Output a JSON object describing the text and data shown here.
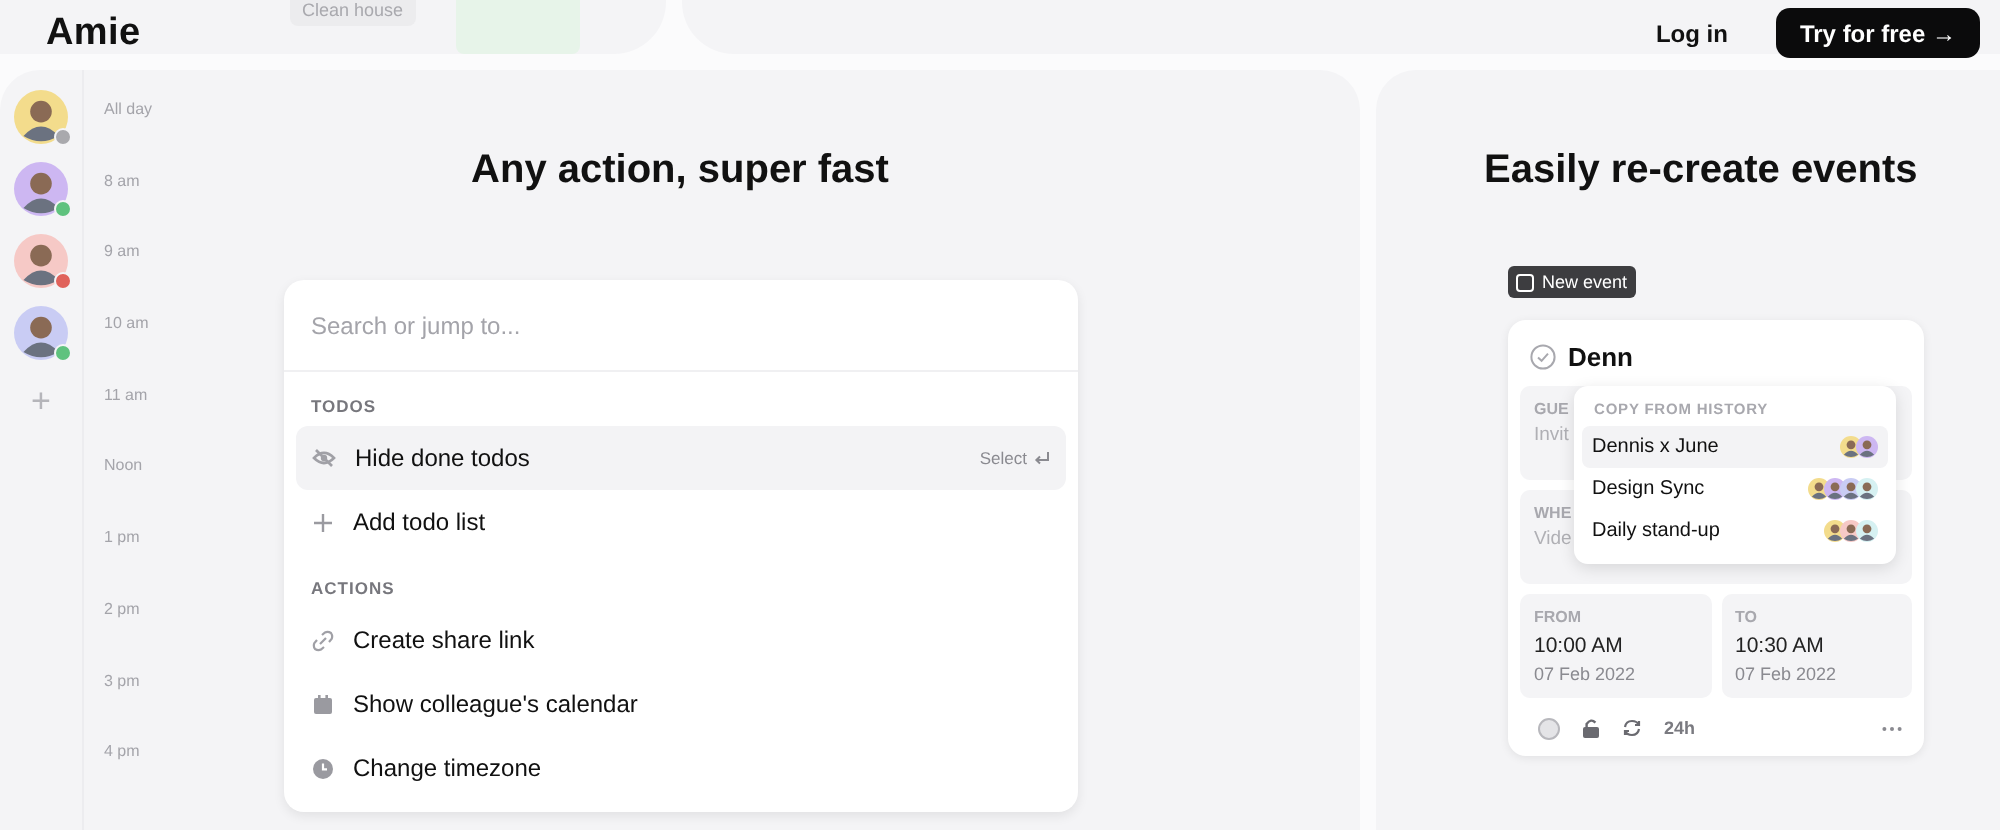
{
  "header": {
    "logo": "Amie",
    "background_cell": "Clean house",
    "login": "Log in",
    "cta": "Try for free →"
  },
  "left_panel": {
    "title": "Any action, super fast",
    "people": [
      {
        "color": "#a9a9ad"
      },
      {
        "color": "#5fc27e"
      },
      {
        "color": "#e0625b"
      },
      {
        "color": "#5fc27e"
      }
    ],
    "add": "+",
    "times": [
      "All day",
      "8 am",
      "9 am",
      "10 am",
      "11 am",
      "Noon",
      "1 pm",
      "2 pm",
      "3 pm",
      "4 pm"
    ],
    "palette": {
      "placeholder": "Search or jump to...",
      "sections": [
        {
          "heading": "TODOS",
          "items": [
            {
              "label": "Hide done todos",
              "selected": true,
              "hint": "Select"
            },
            {
              "label": "Add todo list",
              "selected": false
            }
          ]
        },
        {
          "heading": "ACTIONS",
          "items": [
            {
              "label": "Create share link",
              "selected": false
            },
            {
              "label": "Show colleague's calendar",
              "selected": false
            },
            {
              "label": "Change timezone",
              "selected": false
            }
          ]
        }
      ]
    }
  },
  "right_panel": {
    "title": "Easily re-create events",
    "chip": "New event",
    "event": {
      "title": "Denn",
      "guests_label": "GUE",
      "guests_value": "Invit",
      "where_label": "WHE",
      "where_value": "Vide",
      "from_label": "FROM",
      "from_time": "10:00 AM",
      "from_date": "07 Feb 2022",
      "to_label": "TO",
      "to_time": "10:30 AM",
      "to_date": "07 Feb 2022",
      "duration": "24h"
    },
    "history": {
      "heading": "COPY FROM HISTORY",
      "items": [
        {
          "label": "Dennis x June",
          "selected": true
        },
        {
          "label": "Design Sync",
          "selected": false
        },
        {
          "label": "Daily stand-up",
          "selected": false
        }
      ]
    }
  }
}
